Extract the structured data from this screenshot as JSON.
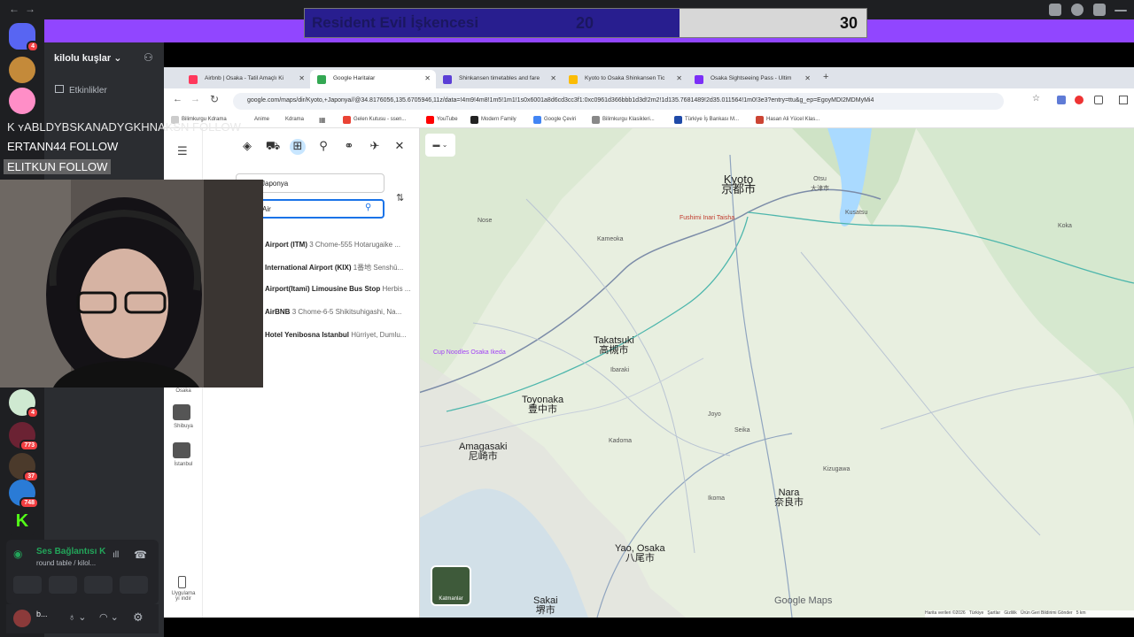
{
  "discord": {
    "nav_back": "←",
    "nav_fwd": "→",
    "server_name": "kilolu kuşlar",
    "events": "Etkinlikler",
    "badges": [
      "3",
      "773",
      "37",
      "748",
      "4"
    ],
    "voice_status": "Ses Bağlantısı K",
    "voice_channel": "round table / kilol...",
    "user_short": "b..."
  },
  "score": {
    "title": "Resident Evil İşkencesi",
    "left": "20",
    "right": "30"
  },
  "overlay": [
    "K  ʏABLDYBSKANADYGKHNAKSN  FOLLOW",
    "ERTANN44  FOLLOW",
    "ELITKUN  FOLLOW"
  ],
  "browser": {
    "tabs": [
      {
        "label": "Airbnb | Osaka - Tatil Amaçlı Ki",
        "color": "#ff385c"
      },
      {
        "label": "Google Haritalar",
        "color": "#34a853"
      },
      {
        "label": "Shinkansen timetables and fare",
        "color": "#5b3fd6"
      },
      {
        "label": "Kyoto to Osaka Shinkansen Tic",
        "color": "#fbbc05"
      },
      {
        "label": "Osaka Sightseeing Pass - Ultim",
        "color": "#7b2ff7"
      }
    ],
    "url": "google.com/maps/dir/Kyoto,+Japonya//@34.8176056,135.6705946,11z/data=!4m9!4m8!1m5!1m1!1s0x6001a8d6cd3cc3f1:0xc0961d366bbb1d3d!2m2!1d135.7681489!2d35.011564!1m0!3e3?entry=ttu&g_ep=EgoyMDI2MDMyMi4",
    "bookmarks": [
      {
        "label": "Bilimkurgu Kdrama",
        "color": "#888"
      },
      {
        "label": "Anime",
        "color": "#fff"
      },
      {
        "label": "Kdrama",
        "color": "#fff"
      },
      {
        "label": "Gelen Kutusu - ssen...",
        "color": "#ea4335"
      },
      {
        "label": "YouTube",
        "color": "#ff0000"
      },
      {
        "label": "Modern Family",
        "color": "#222"
      },
      {
        "label": "Google Çeviri",
        "color": "#4285f4"
      },
      {
        "label": "Bilimkurgu Klasikleri...",
        "color": "#888"
      },
      {
        "label": "Türkiye İş Bankası M...",
        "color": "#1f4aa8"
      },
      {
        "label": "Hasan Ali Yücel Klas...",
        "color": "#c43"
      }
    ]
  },
  "maps": {
    "from": "Japonya",
    "to": "Air",
    "suggestions": [
      {
        "name": "Airport (ITM)",
        "addr": "3 Chome-555 Hotarugaike ..."
      },
      {
        "name": "International Airport (KIX)",
        "addr": "1番地 Senshū..."
      },
      {
        "name": "Airport(Itami) Limousine Bus Stop",
        "addr": "Herbis ..."
      },
      {
        "name": "AirBNB",
        "addr": "3 Chome-6-5 Shikitsuhigashi, Na..."
      },
      {
        "name": "Hotel Yenibosna Istanbul",
        "addr": "Hürriyet, Dumlu..."
      }
    ],
    "rail": [
      {
        "label": "Osaka"
      },
      {
        "label": "Shibuya"
      },
      {
        "label": "İstanbul"
      },
      {
        "label": "Uygulama\nyı indir"
      }
    ],
    "cities": [
      {
        "en": "Kyoto",
        "jp": "京都市"
      },
      {
        "en": "Takatsuki",
        "jp": "高槻市"
      },
      {
        "en": "Toyonaka",
        "jp": "豊中市"
      },
      {
        "en": "Amagasaki",
        "jp": "尼崎市"
      },
      {
        "en": "Nara",
        "jp": "奈良市"
      },
      {
        "en": "Yao, Osaka",
        "jp": "八尾市"
      },
      {
        "en": "Sakai",
        "jp": "堺市"
      },
      {
        "en": "Otsu",
        "jp": "大津市"
      }
    ],
    "small_places": [
      "Cup Noodles Osaka Ikeda",
      "Fushimi Inari Taisha",
      "Nose",
      "Kameoka",
      "Kusatsu",
      "Koka",
      "Ibaraki",
      "Kadoma",
      "Joyo",
      "Seika",
      "Ikoma",
      "Kizugawa"
    ],
    "layers_label": "Katmanlar",
    "footer": [
      "Harita verileri ©2026",
      "Türkiye",
      "Şartlar",
      "Gizlilik",
      "Ürün Geri Bildirimi Gönder",
      "5 km"
    ],
    "logo": "Google Maps"
  }
}
